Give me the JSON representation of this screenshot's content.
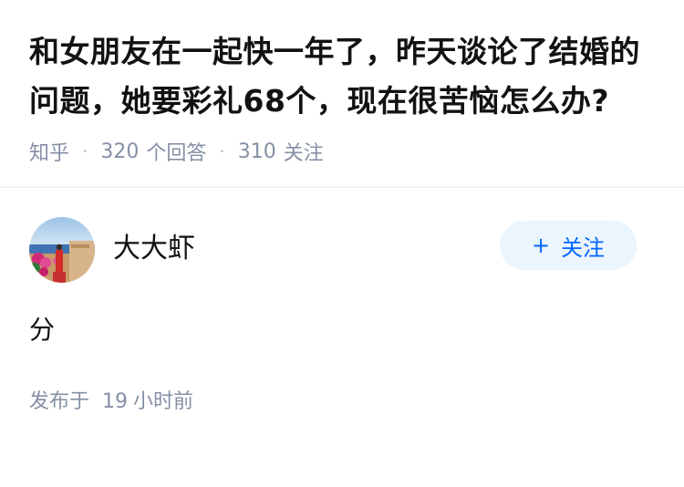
{
  "question": {
    "title": "和女朋友在一起快一年了，昨天谈论了结婚的问题，她要彩礼68个，现在很苦恼怎么办?",
    "source": "知乎",
    "separator": "·",
    "answer_count": "320",
    "answer_label": "个回答",
    "follow_count": "310",
    "follow_label": "关注"
  },
  "answer": {
    "author_name": "大大虾",
    "follow_button_plus": "+",
    "follow_button_label": "关注",
    "content": "分",
    "time_prefix": "发布于",
    "time_num": "19",
    "time_suffix": "小时前"
  },
  "colors": {
    "accent": "#0066ff",
    "follow_bg": "#ebf5fd",
    "meta_gray": "#8590a6",
    "text": "#121212"
  },
  "icons": {
    "avatar": "avatar-photo"
  }
}
